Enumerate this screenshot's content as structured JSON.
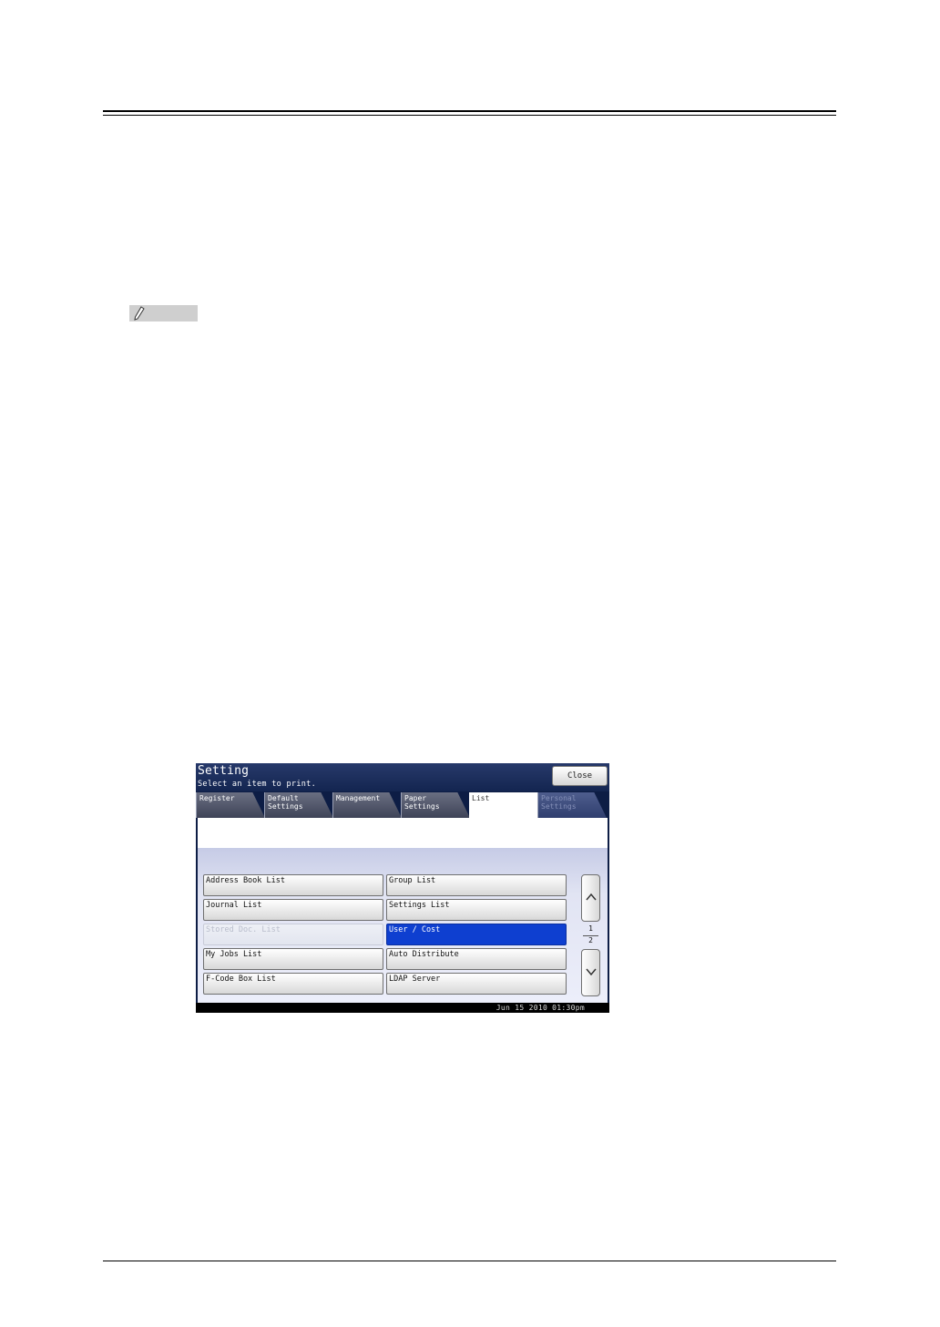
{
  "screen": {
    "title": "Setting",
    "subtitle": "Select an item to print.",
    "close_label": "Close",
    "tabs": [
      {
        "line1": "Register",
        "line2": ""
      },
      {
        "line1": "Default",
        "line2": "Settings"
      },
      {
        "line1": "Management",
        "line2": ""
      },
      {
        "line1": "Paper",
        "line2": "Settings"
      },
      {
        "line1": "List",
        "line2": ""
      },
      {
        "line1": "Personal",
        "line2": "Settings"
      }
    ],
    "items": [
      "Address Book List",
      "Group List",
      "Journal List",
      "Settings List",
      "Stored Doc. List",
      "User / Cost",
      "My Jobs List",
      "Auto Distribute",
      "F-Code Box List",
      "LDAP Server"
    ],
    "page_current": "1",
    "page_total": "2",
    "datetime": "Jun 15 2010 01:30pm"
  },
  "colors": {
    "selected": "#0e3fd0",
    "header": "#132550"
  },
  "icons": [
    "note-pencil-icon",
    "chevron-up-icon",
    "chevron-down-icon"
  ]
}
